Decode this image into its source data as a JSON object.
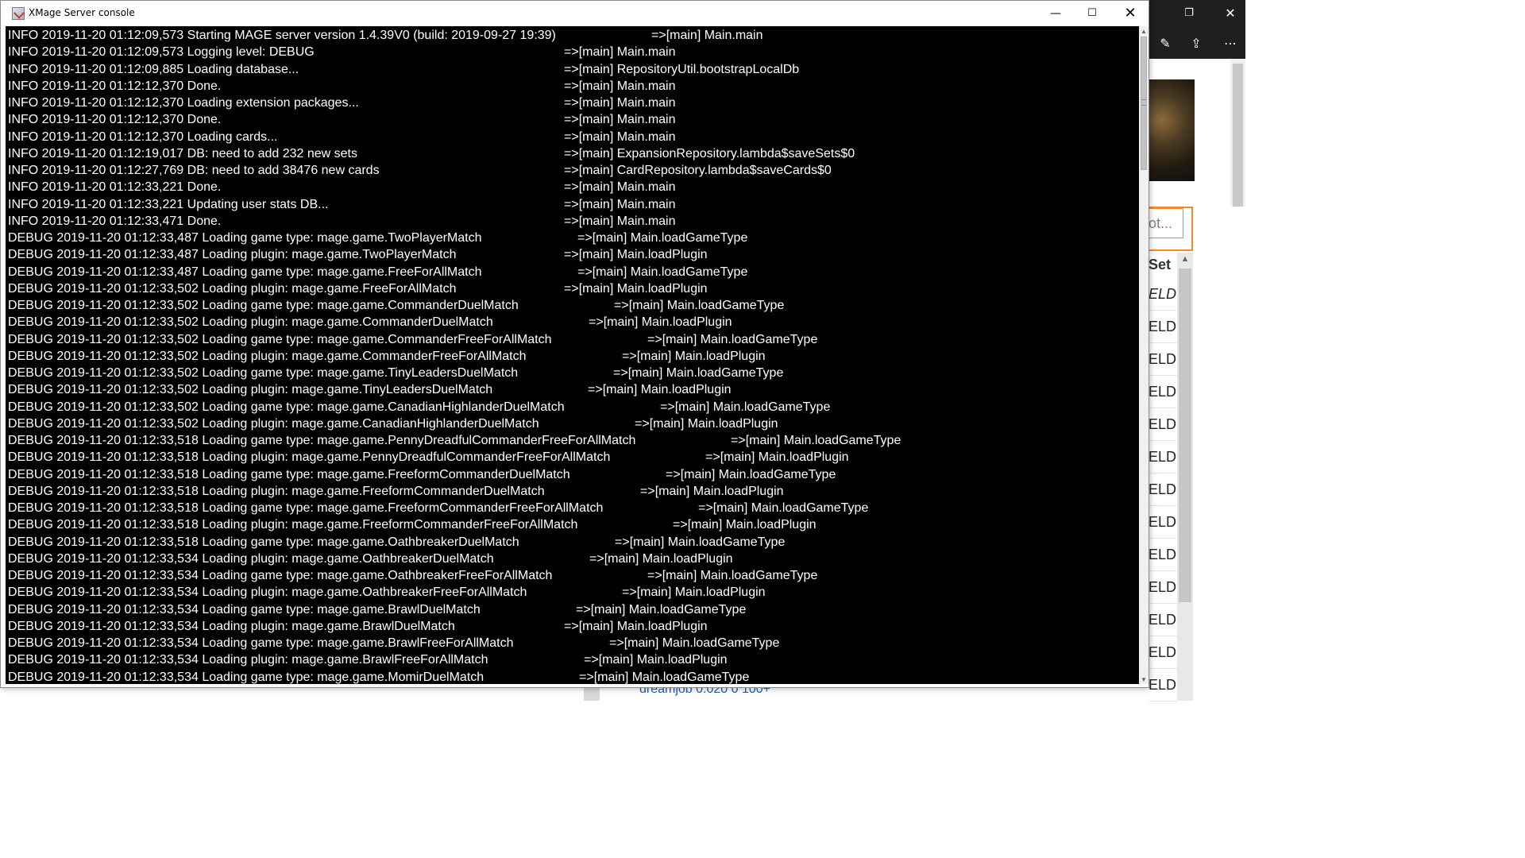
{
  "window": {
    "title": "XMage Server console",
    "minimize_glyph": "—",
    "maximize_glyph": "☐",
    "close_glyph": "✕"
  },
  "background_app": {
    "restore_glyph": "❐",
    "close_glyph": "✕",
    "pen_glyph": "✎",
    "share_glyph": "⇪",
    "more_glyph": "⋯",
    "search_placeholder": "ot...",
    "set_column_header": "Set",
    "set_cells": [
      "ELD",
      "ELD",
      "ELD",
      "ELD",
      "ELD",
      "ELD",
      "ELD",
      "ELD",
      "ELD",
      "ELD",
      "ELD",
      "ELD",
      "ELD"
    ],
    "bottom_text": "dreamjob          0.020          0          100+",
    "scroll_up_glyph": "▲",
    "accent_orange": "#f28b30"
  },
  "console": {
    "scroll_up_glyph": "▲",
    "scroll_down_glyph": "▼",
    "lines": [
      {
        "msg": "INFO  2019-11-20 01:12:09,573 Starting MAGE server version 1.4.39V0 (build: 2019-09-27 19:39)",
        "src": "=>[main] Main.main"
      },
      {
        "msg": "INFO  2019-11-20 01:12:09,573 Logging level: DEBUG",
        "src": "=>[main] Main.main"
      },
      {
        "msg": "INFO  2019-11-20 01:12:09,885 Loading database...",
        "src": "=>[main] RepositoryUtil.bootstrapLocalDb"
      },
      {
        "msg": "INFO  2019-11-20 01:12:12,370 Done.",
        "src": "=>[main] Main.main"
      },
      {
        "msg": "INFO  2019-11-20 01:12:12,370 Loading extension packages...",
        "src": "=>[main] Main.main"
      },
      {
        "msg": "INFO  2019-11-20 01:12:12,370 Done.",
        "src": "=>[main] Main.main"
      },
      {
        "msg": "INFO  2019-11-20 01:12:12,370 Loading cards...",
        "src": "=>[main] Main.main"
      },
      {
        "msg": "INFO  2019-11-20 01:12:19,017 DB: need to add 232 new sets",
        "src": "=>[main] ExpansionRepository.lambda$saveSets$0"
      },
      {
        "msg": "INFO  2019-11-20 01:12:27,769 DB: need to add 38476 new cards",
        "src": "=>[main] CardRepository.lambda$saveCards$0"
      },
      {
        "msg": "INFO  2019-11-20 01:12:33,221 Done.",
        "src": "=>[main] Main.main"
      },
      {
        "msg": "INFO  2019-11-20 01:12:33,221 Updating user stats DB...",
        "src": "=>[main] Main.main"
      },
      {
        "msg": "INFO  2019-11-20 01:12:33,471 Done.",
        "src": "=>[main] Main.main"
      },
      {
        "msg": "DEBUG 2019-11-20 01:12:33,487 Loading game type: mage.game.TwoPlayerMatch",
        "src": "=>[main] Main.loadGameType"
      },
      {
        "msg": "DEBUG 2019-11-20 01:12:33,487 Loading plugin: mage.game.TwoPlayerMatch",
        "src": "=>[main] Main.loadPlugin"
      },
      {
        "msg": "DEBUG 2019-11-20 01:12:33,487 Loading game type: mage.game.FreeForAllMatch",
        "src": "=>[main] Main.loadGameType"
      },
      {
        "msg": "DEBUG 2019-11-20 01:12:33,502 Loading plugin: mage.game.FreeForAllMatch",
        "src": "=>[main] Main.loadPlugin"
      },
      {
        "msg": "DEBUG 2019-11-20 01:12:33,502 Loading game type: mage.game.CommanderDuelMatch",
        "src": "=>[main] Main.loadGameType"
      },
      {
        "msg": "DEBUG 2019-11-20 01:12:33,502 Loading plugin: mage.game.CommanderDuelMatch",
        "src": "=>[main] Main.loadPlugin"
      },
      {
        "msg": "DEBUG 2019-11-20 01:12:33,502 Loading game type: mage.game.CommanderFreeForAllMatch",
        "src": "=>[main] Main.loadGameType"
      },
      {
        "msg": "DEBUG 2019-11-20 01:12:33,502 Loading plugin: mage.game.CommanderFreeForAllMatch",
        "src": "=>[main] Main.loadPlugin"
      },
      {
        "msg": "DEBUG 2019-11-20 01:12:33,502 Loading game type: mage.game.TinyLeadersDuelMatch",
        "src": "=>[main] Main.loadGameType"
      },
      {
        "msg": "DEBUG 2019-11-20 01:12:33,502 Loading plugin: mage.game.TinyLeadersDuelMatch",
        "src": "=>[main] Main.loadPlugin"
      },
      {
        "msg": "DEBUG 2019-11-20 01:12:33,502 Loading game type: mage.game.CanadianHighlanderDuelMatch",
        "src": "=>[main] Main.loadGameType"
      },
      {
        "msg": "DEBUG 2019-11-20 01:12:33,502 Loading plugin: mage.game.CanadianHighlanderDuelMatch",
        "src": "=>[main] Main.loadPlugin"
      },
      {
        "msg": "DEBUG 2019-11-20 01:12:33,518 Loading game type: mage.game.PennyDreadfulCommanderFreeForAllMatch",
        "src": "=>[main] Main.loadGameType"
      },
      {
        "msg": "DEBUG 2019-11-20 01:12:33,518 Loading plugin: mage.game.PennyDreadfulCommanderFreeForAllMatch",
        "src": "=>[main] Main.loadPlugin"
      },
      {
        "msg": "DEBUG 2019-11-20 01:12:33,518 Loading game type: mage.game.FreeformCommanderDuelMatch",
        "src": "=>[main] Main.loadGameType"
      },
      {
        "msg": "DEBUG 2019-11-20 01:12:33,518 Loading plugin: mage.game.FreeformCommanderDuelMatch",
        "src": "=>[main] Main.loadPlugin"
      },
      {
        "msg": "DEBUG 2019-11-20 01:12:33,518 Loading game type: mage.game.FreeformCommanderFreeForAllMatch",
        "src": "=>[main] Main.loadGameType"
      },
      {
        "msg": "DEBUG 2019-11-20 01:12:33,518 Loading plugin: mage.game.FreeformCommanderFreeForAllMatch",
        "src": "=>[main] Main.loadPlugin"
      },
      {
        "msg": "DEBUG 2019-11-20 01:12:33,518 Loading game type: mage.game.OathbreakerDuelMatch",
        "src": "=>[main] Main.loadGameType"
      },
      {
        "msg": "DEBUG 2019-11-20 01:12:33,534 Loading plugin: mage.game.OathbreakerDuelMatch",
        "src": "=>[main] Main.loadPlugin"
      },
      {
        "msg": "DEBUG 2019-11-20 01:12:33,534 Loading game type: mage.game.OathbreakerFreeForAllMatch",
        "src": "=>[main] Main.loadGameType"
      },
      {
        "msg": "DEBUG 2019-11-20 01:12:33,534 Loading plugin: mage.game.OathbreakerFreeForAllMatch",
        "src": "=>[main] Main.loadPlugin"
      },
      {
        "msg": "DEBUG 2019-11-20 01:12:33,534 Loading game type: mage.game.BrawlDuelMatch",
        "src": "=>[main] Main.loadGameType"
      },
      {
        "msg": "DEBUG 2019-11-20 01:12:33,534 Loading plugin: mage.game.BrawlDuelMatch",
        "src": "=>[main] Main.loadPlugin"
      },
      {
        "msg": "DEBUG 2019-11-20 01:12:33,534 Loading game type: mage.game.BrawlFreeForAllMatch",
        "src": "=>[main] Main.loadGameType"
      },
      {
        "msg": "DEBUG 2019-11-20 01:12:33,534 Loading plugin: mage.game.BrawlFreeForAllMatch",
        "src": "=>[main] Main.loadPlugin"
      },
      {
        "msg": "DEBUG 2019-11-20 01:12:33,534 Loading game type: mage.game.MomirDuelMatch",
        "src": "=>[main] Main.loadGameType"
      }
    ]
  }
}
